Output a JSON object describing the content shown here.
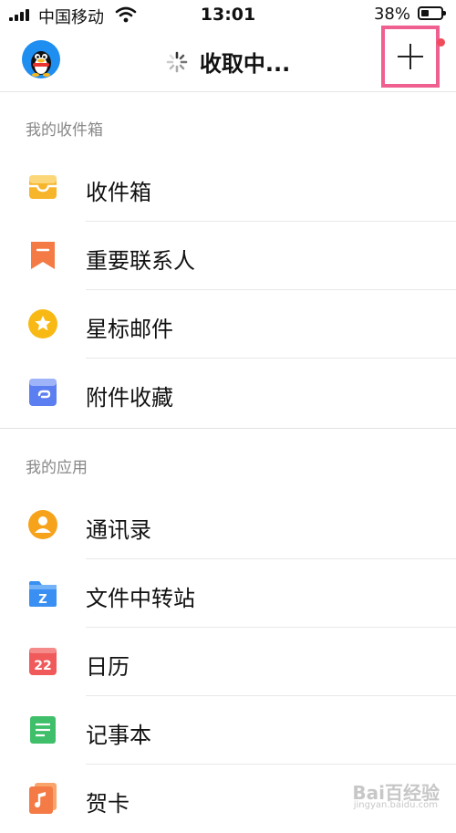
{
  "status_bar": {
    "carrier": "中国移动",
    "time": "13:01",
    "battery_percent": "38%",
    "battery_level": 0.38
  },
  "header": {
    "title": "收取中...",
    "avatar_icon": "qq-penguin-avatar",
    "add_icon": "plus-icon",
    "notification_dot_color": "#f04b5a",
    "highlight_color": "#ef5f8f"
  },
  "sections": [
    {
      "title": "我的收件箱",
      "items": [
        {
          "label": "收件箱",
          "icon": "inbox-tray-icon",
          "color": "#f7b52c"
        },
        {
          "label": "重要联系人",
          "icon": "bookmark-icon",
          "color": "#f47b45"
        },
        {
          "label": "星标邮件",
          "icon": "star-icon",
          "color": "#f8b914"
        },
        {
          "label": "附件收藏",
          "icon": "attachment-icon",
          "color": "#5b7ff0"
        }
      ]
    },
    {
      "title": "我的应用",
      "items": [
        {
          "label": "通讯录",
          "icon": "contacts-icon",
          "color": "#f7a21b"
        },
        {
          "label": "文件中转站",
          "icon": "folder-z-icon",
          "color": "#3a8ff2"
        },
        {
          "label": "日历",
          "icon": "calendar-icon",
          "color": "#f05a5a",
          "icon_text": "22"
        },
        {
          "label": "记事本",
          "icon": "notebook-icon",
          "color": "#3fbf6a"
        },
        {
          "label": "贺卡",
          "icon": "music-card-icon",
          "color": "#f47b45"
        }
      ]
    }
  ],
  "watermark": {
    "text": "Bai百经验",
    "sub": "jingyan.baidu.com"
  }
}
